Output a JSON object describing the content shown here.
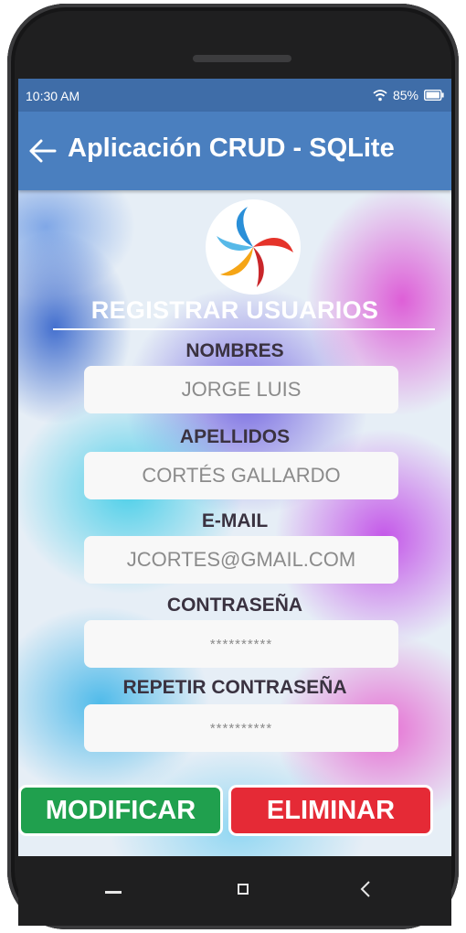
{
  "status_bar": {
    "time": "10:30 AM",
    "battery_text": "85%",
    "icons": [
      "wifi-icon",
      "battery-icon"
    ]
  },
  "app_bar": {
    "title": "Aplicación CRUD - SQLite",
    "back_icon": "arrow-left-icon"
  },
  "form": {
    "section_title": "REGISTRAR USUARIOS",
    "fields": [
      {
        "label": "NOMBRES",
        "value": "JORGE LUIS"
      },
      {
        "label": "APELLIDOS",
        "value": "CORTÉS GALLARDO"
      },
      {
        "label": "E-MAIL",
        "value": "JCORTES@GMAIL.COM"
      },
      {
        "label": "CONTRASEÑA",
        "value": "**********"
      },
      {
        "label": "REPETIR CONTRASEÑA",
        "value": "**********"
      }
    ]
  },
  "actions": {
    "modify_label": "MODIFICAR",
    "delete_label": "ELIMINAR"
  },
  "colors": {
    "status_bar": "#3f6da8",
    "app_bar": "#4a7fbf",
    "modify_button": "#20a04e",
    "delete_button": "#e52a36"
  },
  "nav_bar": {
    "icons": [
      "nav-back-icon",
      "nav-home-icon",
      "nav-recents-icon"
    ]
  }
}
